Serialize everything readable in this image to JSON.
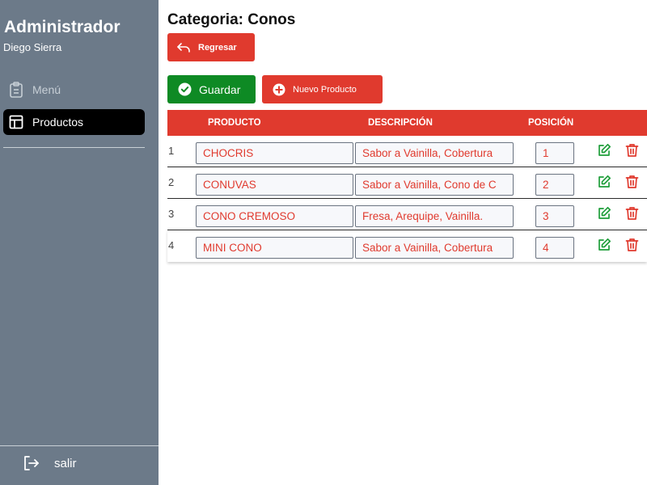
{
  "sidebar": {
    "title": "Administrador",
    "user": "Diego Sierra",
    "items": [
      {
        "label": "Menú",
        "icon": "clipboard-icon"
      },
      {
        "label": "Productos",
        "icon": "layout-icon"
      }
    ],
    "logout_label": "salir"
  },
  "header": {
    "title": "Categoria: Conos",
    "back_label": "Regresar"
  },
  "toolbar": {
    "save_label": "Guardar",
    "new_label": "Nuevo Producto"
  },
  "table": {
    "columns": [
      "PRODUCTO",
      "DESCRIPCIÓN",
      "POSICIÓN"
    ],
    "rows": [
      {
        "num": "1",
        "name": "CHOCRIS",
        "desc": "Sabor a Vainilla, Cobertura",
        "pos": "1"
      },
      {
        "num": "2",
        "name": "CONUVAS",
        "desc": "Sabor a Vainilla, Cono de C",
        "pos": "2"
      },
      {
        "num": "3",
        "name": "CONO CREMOSO",
        "desc": "Fresa, Arequipe, Vainilla.",
        "pos": "3"
      },
      {
        "num": "4",
        "name": "MINI CONO",
        "desc": "Sabor a Vainilla, Cobertura",
        "pos": "4"
      }
    ]
  },
  "colors": {
    "sidebar_bg": "#6c7a89",
    "accent_red": "#e03a2e",
    "save_green": "#0e8a24",
    "edit_green": "#1e9e3a",
    "active_item_bg": "#000000"
  }
}
